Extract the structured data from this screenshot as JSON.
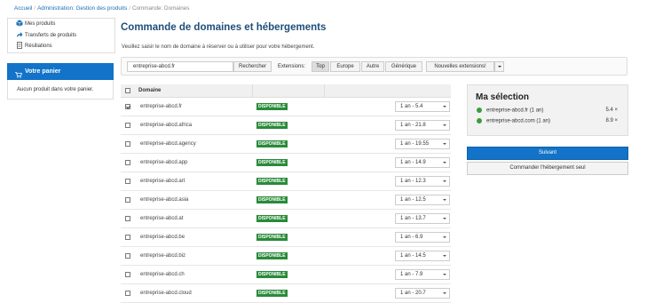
{
  "breadcrumb": {
    "home": "Accueil",
    "admin": "Administration: Gestion des produits",
    "current": "Commande: Domaines"
  },
  "sidebar": {
    "items": [
      {
        "label": "Mes produits",
        "icon": "cube-icon"
      },
      {
        "label": "Transferts de produits",
        "icon": "transfer-arrow-icon"
      },
      {
        "label": "Résiliations",
        "icon": "document-icon"
      }
    ]
  },
  "cart": {
    "title": "Votre panier",
    "empty": "Aucun produit dans votre panier."
  },
  "page": {
    "title": "Commande de domaines et hébergements",
    "intro": "Veuillez saisir le nom de domaine à réserver ou à utiliser pour votre hébergement."
  },
  "search": {
    "value": "entreprise-abcd.fr",
    "button": "Rechercher",
    "extensions_label": "Extensions:",
    "tabs": [
      "Top",
      "Europe",
      "Autre",
      "Générique"
    ],
    "active_tab": "Top",
    "new_ext": "Nouvelles extensions!"
  },
  "table": {
    "header": "Domaine",
    "status_label": "DISPONIBLE",
    "rows": [
      {
        "domain": "entreprise-abcd.fr",
        "price": "1 an - 5.4",
        "checked": true
      },
      {
        "domain": "entreprise-abcd.africa",
        "price": "1 an - 21.8",
        "checked": false
      },
      {
        "domain": "entreprise-abcd.agency",
        "price": "1 an - 19.55",
        "checked": false
      },
      {
        "domain": "entreprise-abcd.app",
        "price": "1 an - 14.9",
        "checked": false
      },
      {
        "domain": "entreprise-abcd.art",
        "price": "1 an - 12.3",
        "checked": false
      },
      {
        "domain": "entreprise-abcd.asia",
        "price": "1 an - 12.5",
        "checked": false
      },
      {
        "domain": "entreprise-abcd.at",
        "price": "1 an - 13.7",
        "checked": false
      },
      {
        "domain": "entreprise-abcd.be",
        "price": "1 an - 6.9",
        "checked": false
      },
      {
        "domain": "entreprise-abcd.biz",
        "price": "1 an - 14.5",
        "checked": false
      },
      {
        "domain": "entreprise-abcd.ch",
        "price": "1 an - 7.9",
        "checked": false
      },
      {
        "domain": "entreprise-abcd.cloud",
        "price": "1 an - 20.7",
        "checked": false
      }
    ]
  },
  "selection": {
    "title": "Ma sélection",
    "items": [
      {
        "label": "entreprise-abcd.fr (1 an)",
        "price": "5.4 ×"
      },
      {
        "label": "entreprise-abcd.com (1 an)",
        "price": "8.9 ×"
      }
    ],
    "next": "Suivant",
    "host_only": "Commander l'hébergement seul"
  },
  "colors": {
    "primary": "#1273c8",
    "title": "#1f4f79",
    "available": "#2a8a3a",
    "dot": "#3c9c3c"
  }
}
